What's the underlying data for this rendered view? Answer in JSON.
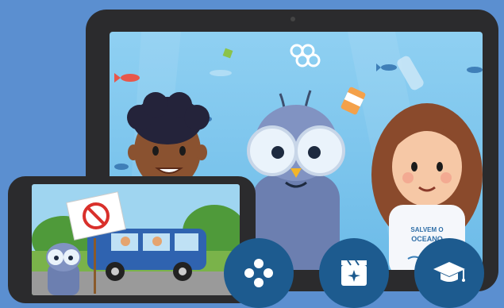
{
  "hero": {
    "shirt_line1": "SALVEM O",
    "shirt_line2": "OCEANO"
  },
  "icons": {
    "games": "gamepad-dots-icon",
    "videos": "clapperboard-sparkle-icon",
    "education": "graduation-cap-icon"
  },
  "colors": {
    "background": "#5b8fd0",
    "device_frame": "#2b2b2d",
    "button": "#1d5b8f",
    "ocean": "#7dc4ee"
  }
}
